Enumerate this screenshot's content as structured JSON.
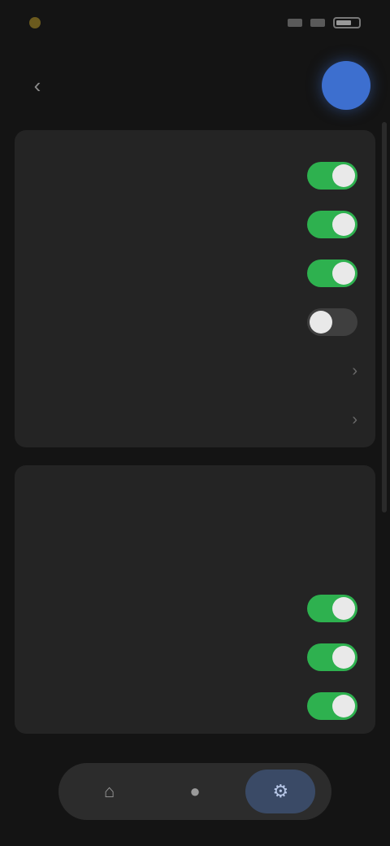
{
  "status": {
    "time": "",
    "icons": [
      "signal-icon",
      "wifi-icon",
      "battery-icon"
    ]
  },
  "app_bar": {
    "title": "",
    "back_icon": "back-arrow-icon",
    "avatar_color": "#3d6fcf"
  },
  "sections": [
    {
      "header": "",
      "rows": [
        {
          "label": "",
          "type": "toggle",
          "on": true
        },
        {
          "label": "",
          "type": "toggle",
          "on": true
        },
        {
          "label": "",
          "type": "toggle",
          "on": true
        },
        {
          "label": "",
          "type": "toggle",
          "on": false
        },
        {
          "label": "",
          "type": "nav",
          "value": ""
        },
        {
          "label": "",
          "type": "nav",
          "value": ""
        }
      ]
    },
    {
      "header": "",
      "rows": [
        {
          "label": "",
          "type": "value",
          "value": ""
        },
        {
          "label": "",
          "type": "value",
          "value": ""
        },
        {
          "label": "",
          "type": "toggle",
          "on": true
        },
        {
          "label": "",
          "type": "toggle",
          "on": true
        },
        {
          "label": "",
          "type": "toggle",
          "on": true
        }
      ]
    }
  ],
  "bottom_nav": {
    "items": [
      {
        "icon": "home-icon",
        "active": false
      },
      {
        "icon": "person-icon",
        "active": false
      },
      {
        "icon": "settings-icon",
        "active": true
      }
    ]
  },
  "colors": {
    "background": "#141414",
    "card": "#242424",
    "toggle_on": "#2eb14f",
    "toggle_off": "#3f3f3f",
    "accent": "#3d6fcf"
  }
}
